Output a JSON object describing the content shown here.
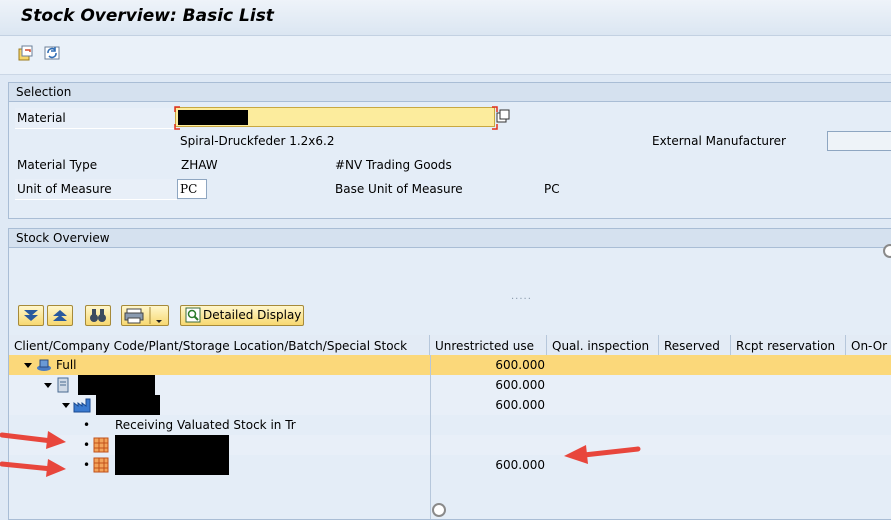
{
  "window": {
    "title": "Stock Overview: Basic List"
  },
  "toolbar": {
    "icons": [
      "new-window-icon",
      "refresh-icon"
    ]
  },
  "selection": {
    "title": "Selection",
    "material_label": "Material",
    "material_description": "Spiral-Druckfeder 1.2x6.2",
    "external_manufacturer_label": "External Manufacturer",
    "material_type_label": "Material Type",
    "material_type_code": "ZHAW",
    "material_type_text": "#NV Trading Goods",
    "uom_label": "Unit of Measure",
    "uom_value": "PC",
    "base_uom_label": "Base Unit of Measure",
    "base_uom_value": "PC"
  },
  "stock_overview": {
    "title": "Stock Overview",
    "detailed_display_label": "Detailed Display",
    "columns": [
      "Client/Company Code/Plant/Storage Location/Batch/Special Stock",
      "Unrestricted use",
      "Qual. inspection",
      "Reserved",
      "Rcpt reservation",
      "On-Or"
    ],
    "rows": [
      {
        "name": "Full",
        "unrestricted": "600.000"
      },
      {
        "name": "",
        "unrestricted": "600.000"
      },
      {
        "name": "",
        "unrestricted": "600.000"
      },
      {
        "name": "Receiving Valuated Stock in Tr",
        "unrestricted": ""
      },
      {
        "name": "",
        "unrestricted": ""
      },
      {
        "name": "",
        "unrestricted": "600.000"
      }
    ]
  },
  "colors": {
    "highlight_row": "#fbd87a",
    "annotation_arrow": "#e8463c"
  }
}
